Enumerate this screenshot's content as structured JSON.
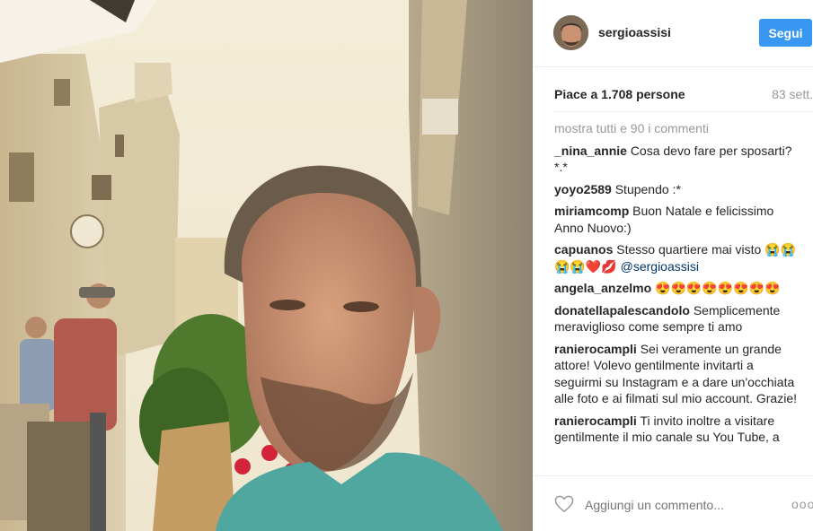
{
  "post": {
    "username": "sergioassisi",
    "follow_label": "Segui",
    "likes_text": "Piace a 1.708 persone",
    "time_ago": "83 sett.",
    "show_all_comments": "mostra tutti e 90 i commenti",
    "comment_placeholder": "Aggiungi un commento...",
    "more_options": "ooo"
  },
  "comments": [
    {
      "user": "_nina_annie",
      "text": "Cosa devo fare per sposarti? *.*"
    },
    {
      "user": "yoyo2589",
      "text": "Stupendo :*"
    },
    {
      "user": "miriamcomp",
      "text": "Buon Natale e felicissimo Anno Nuovo:)"
    },
    {
      "user": "capuanos",
      "text": "Stesso quartiere mai visto",
      "trail_emoji": "😭😭😭😭❤️💋",
      "mention": "@sergioassisi"
    },
    {
      "user": "angela_anzelmo",
      "text": "",
      "emoji": "😍😍😍😍😍😍😍😍"
    },
    {
      "user": "donatellapalescandolo",
      "text": "Semplicemente meraviglioso come sempre ti amo"
    },
    {
      "user": "ranierocampli",
      "text": "Sei veramente un grande attore! Volevo gentilmente invitarti a seguirmi su Instagram e a dare un'occhiata alle foto e ai filmati sul mio account. Grazie!"
    },
    {
      "user": "ranierocampli",
      "text": "Ti invito inoltre a visitare gentilmente il mio canale su You Tube, a"
    }
  ],
  "colors": {
    "follow_bg": "#3897f0",
    "username": "#262626",
    "muted": "#999999",
    "mention": "#003569"
  }
}
